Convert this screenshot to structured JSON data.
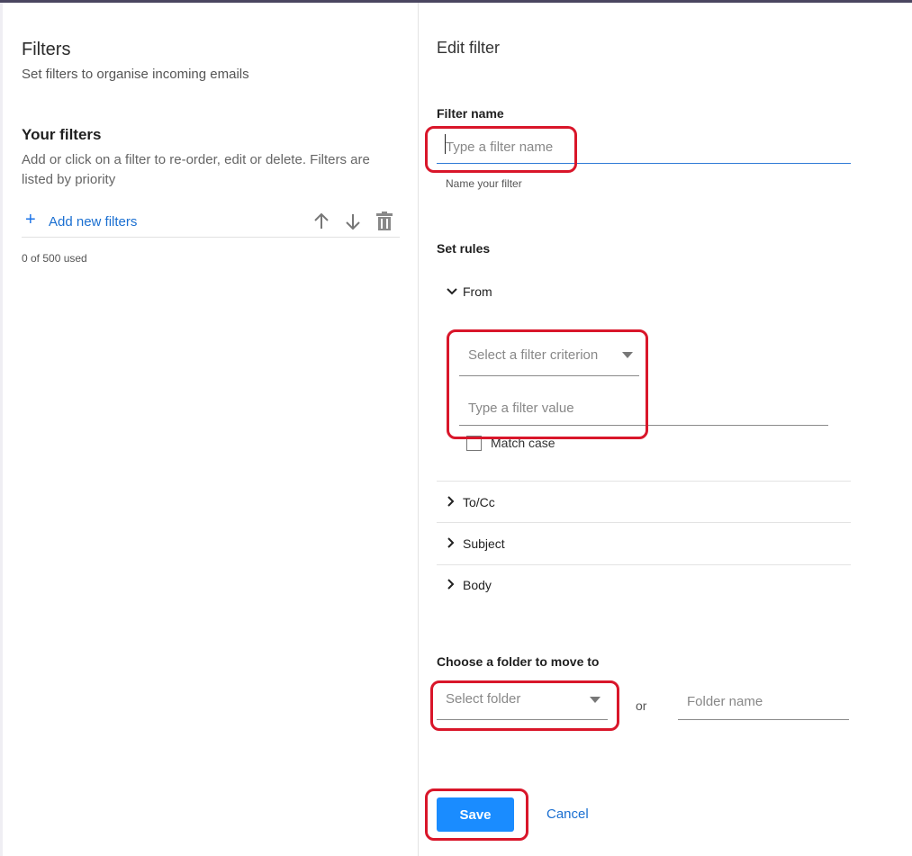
{
  "left": {
    "title": "Filters",
    "subtitle": "Set filters to organise incoming emails",
    "your_filters_title": "Your filters",
    "your_filters_desc": "Add or click on a filter to re-order, edit or delete. Filters are listed by priority",
    "add_label": "Add new filters",
    "icons": [
      "arrow-up-icon",
      "arrow-down-icon",
      "trash-icon"
    ],
    "used": "0 of 500 used"
  },
  "right": {
    "title": "Edit filter",
    "filter_name_label": "Filter name",
    "filter_name_placeholder": "Type a filter name",
    "filter_name_hint": "Name your filter",
    "set_rules_label": "Set rules",
    "rules": [
      {
        "label": "From",
        "expanded": true
      },
      {
        "label": "To/Cc",
        "expanded": false
      },
      {
        "label": "Subject",
        "expanded": false
      },
      {
        "label": "Body",
        "expanded": false
      }
    ],
    "criterion_placeholder": "Select a filter criterion",
    "value_placeholder": "Type a filter value",
    "match_case_label": "Match case",
    "match_case_checked": false,
    "folder_label": "Choose a folder to move to",
    "folder_select_placeholder": "Select folder",
    "or_text": "or",
    "folder_name_placeholder": "Folder name",
    "save_label": "Save",
    "cancel_label": "Cancel"
  },
  "colors": {
    "accent": "#1a8cff",
    "link": "#1a6fd1",
    "annotation": "#d9162a"
  }
}
